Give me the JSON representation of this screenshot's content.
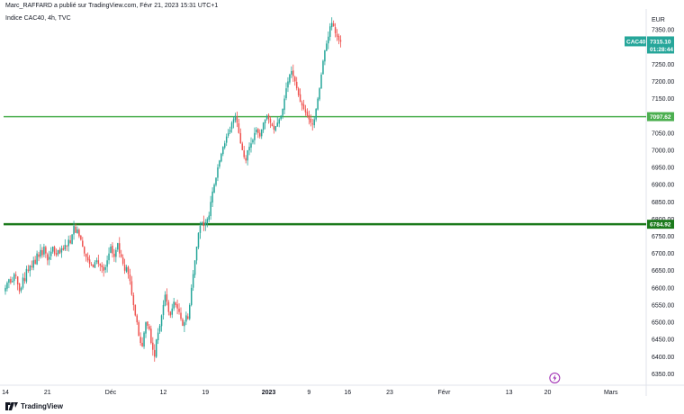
{
  "header": {
    "publisher_line": "Marc_RAFFARD a publié sur TradingView.com, Févr 21, 2023 15:31 UTC+1",
    "symbol_line": "Indice CAC40, 4h, TVC"
  },
  "footer": {
    "brand": "TradingView"
  },
  "colors": {
    "up": "#26a69a",
    "down": "#ef5350",
    "level_light": "#4caf50",
    "level_dark": "#1b7a1b",
    "price_tag": "#26a69a",
    "alert": "#9c27b0"
  },
  "chart_data": {
    "type": "candlestick",
    "title": "",
    "currency_label": "EUR",
    "ylim": [
      6325,
      7400
    ],
    "y_ticks": [
      6350,
      6400,
      6450,
      6500,
      6550,
      6600,
      6650,
      6700,
      6750,
      6800,
      6850,
      6900,
      6950,
      7000,
      7050,
      7100,
      7150,
      7200,
      7250,
      7300,
      7350
    ],
    "y_tick_labels": [
      "6350.00",
      "6400.00",
      "6450.00",
      "6500.00",
      "6550.00",
      "6600.00",
      "6650.00",
      "6700.00",
      "6750.00",
      "6800.00",
      "6850.00",
      "6900.00",
      "6950.00",
      "7000.00",
      "7050.00",
      "7100.00",
      "7150.00",
      "7200.00",
      "7250.00",
      "7300.00",
      "7350.00"
    ],
    "x_ticks": [
      {
        "label": "14",
        "bar": 0,
        "bold": false
      },
      {
        "label": "21",
        "bar": 24,
        "bold": false
      },
      {
        "label": "Déc",
        "bar": 60,
        "bold": false
      },
      {
        "label": "12",
        "bar": 90,
        "bold": false
      },
      {
        "label": "19",
        "bar": 114,
        "bold": false
      },
      {
        "label": "2023",
        "bar": 150,
        "bold": true
      },
      {
        "label": "9",
        "bar": 173,
        "bold": false
      },
      {
        "label": "16",
        "bar": 195,
        "bold": false
      },
      {
        "label": "23",
        "bar": 219,
        "bold": false
      },
      {
        "label": "Févr",
        "bar": 250,
        "bold": false
      },
      {
        "label": "13",
        "bar": 287,
        "bold": false
      },
      {
        "label": "20",
        "bar": 309,
        "bold": false
      },
      {
        "label": "Mars",
        "bar": 345,
        "bold": false
      }
    ],
    "horizontal_levels": [
      {
        "value": 7097.62,
        "label": "7097.62",
        "style": "light"
      },
      {
        "value": 6784.92,
        "label": "6784.92",
        "style": "dark"
      }
    ],
    "current_price": {
      "symbol": "CAC40",
      "value": "7315.10",
      "countdown": "01:28:44",
      "level": 7315.1
    },
    "alert_marker": {
      "icon": "lightning-alert-icon",
      "bar": 313
    },
    "series": [
      {
        "name": "CAC40",
        "closes": [
          6600,
          6615,
          6625,
          6615,
          6620,
          6640,
          6635,
          6610,
          6590,
          6600,
          6630,
          6620,
          6655,
          6650,
          6665,
          6660,
          6680,
          6670,
          6700,
          6690,
          6710,
          6695,
          6720,
          6700,
          6680,
          6690,
          6705,
          6720,
          6700,
          6695,
          6710,
          6700,
          6715,
          6710,
          6725,
          6720,
          6740,
          6730,
          6755,
          6780,
          6760,
          6770,
          6750,
          6740,
          6720,
          6700,
          6690,
          6680,
          6670,
          6665,
          6660,
          6675,
          6680,
          6670,
          6665,
          6660,
          6650,
          6660,
          6680,
          6700,
          6720,
          6700,
          6690,
          6710,
          6730,
          6700,
          6690,
          6670,
          6650,
          6660,
          6640,
          6620,
          6580,
          6550,
          6520,
          6500,
          6460,
          6440,
          6430,
          6470,
          6500,
          6490,
          6480,
          6440,
          6420,
          6400,
          6450,
          6470,
          6490,
          6520,
          6550,
          6580,
          6560,
          6530,
          6520,
          6540,
          6560,
          6550,
          6540,
          6530,
          6510,
          6490,
          6500,
          6520,
          6510,
          6550,
          6600,
          6640,
          6680,
          6720,
          6760,
          6780,
          6790,
          6780,
          6790,
          6800,
          6810,
          6850,
          6880,
          6900,
          6920,
          6950,
          6970,
          6990,
          7010,
          7020,
          7040,
          7050,
          7060,
          7080,
          7090,
          7100,
          7080,
          7050,
          7020,
          7000,
          6980,
          6970,
          7000,
          7010,
          7020,
          7030,
          7050,
          7060,
          7050,
          7040,
          7060,
          7080,
          7090,
          7100,
          7090,
          7080,
          7070,
          7060,
          7070,
          7080,
          7090,
          7100,
          7120,
          7150,
          7180,
          7200,
          7220,
          7230,
          7215,
          7200,
          7180,
          7160,
          7140,
          7130,
          7120,
          7110,
          7100,
          7090,
          7080,
          7075,
          7090,
          7120,
          7150,
          7180,
          7220,
          7260,
          7290,
          7310,
          7330,
          7360,
          7370,
          7360,
          7340,
          7330,
          7320,
          7315.1
        ]
      }
    ]
  }
}
